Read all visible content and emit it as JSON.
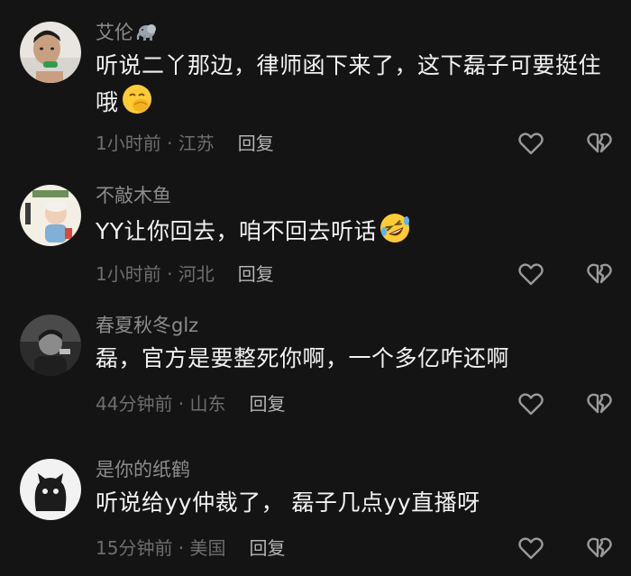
{
  "comments": [
    {
      "username": "艾伦",
      "username_badge": "elephant-icon",
      "text": "听说二丫那边，律师函下来了，这下磊子可要挺住哦",
      "emoji": "face-with-hand-over-mouth-emoji",
      "time_location": "1小时前 · 江苏",
      "reply_label": "回复",
      "like_icon": "heart-outline-icon",
      "dislike_icon": "broken-heart-icon"
    },
    {
      "username": "不敲木鱼",
      "text": "YY让你回去，咱不回去听话",
      "emoji": "rolling-on-floor-laughing-emoji",
      "time_location": "1小时前 · 河北",
      "reply_label": "回复",
      "like_icon": "heart-outline-icon",
      "dislike_icon": "broken-heart-icon"
    },
    {
      "username": "春夏秋冬glz",
      "text": "磊，官方是要整死你啊，一个多亿咋还啊",
      "time_location": "44分钟前 · 山东",
      "reply_label": "回复",
      "like_icon": "heart-outline-icon",
      "dislike_icon": "broken-heart-icon"
    },
    {
      "username": "是你的纸鹤",
      "text": "听说给yy仲裁了， 磊子几点yy直播呀",
      "time_location": "15分钟前 · 美国",
      "reply_label": "回复",
      "like_icon": "heart-outline-icon",
      "dislike_icon": "broken-heart-icon"
    }
  ],
  "colors": {
    "background": "#141414",
    "username": "#8c8c8c",
    "text": "#f2f2f2",
    "meta": "#6e6e6e",
    "reply": "#b4b4b4",
    "icon": "#9a9a9a"
  }
}
